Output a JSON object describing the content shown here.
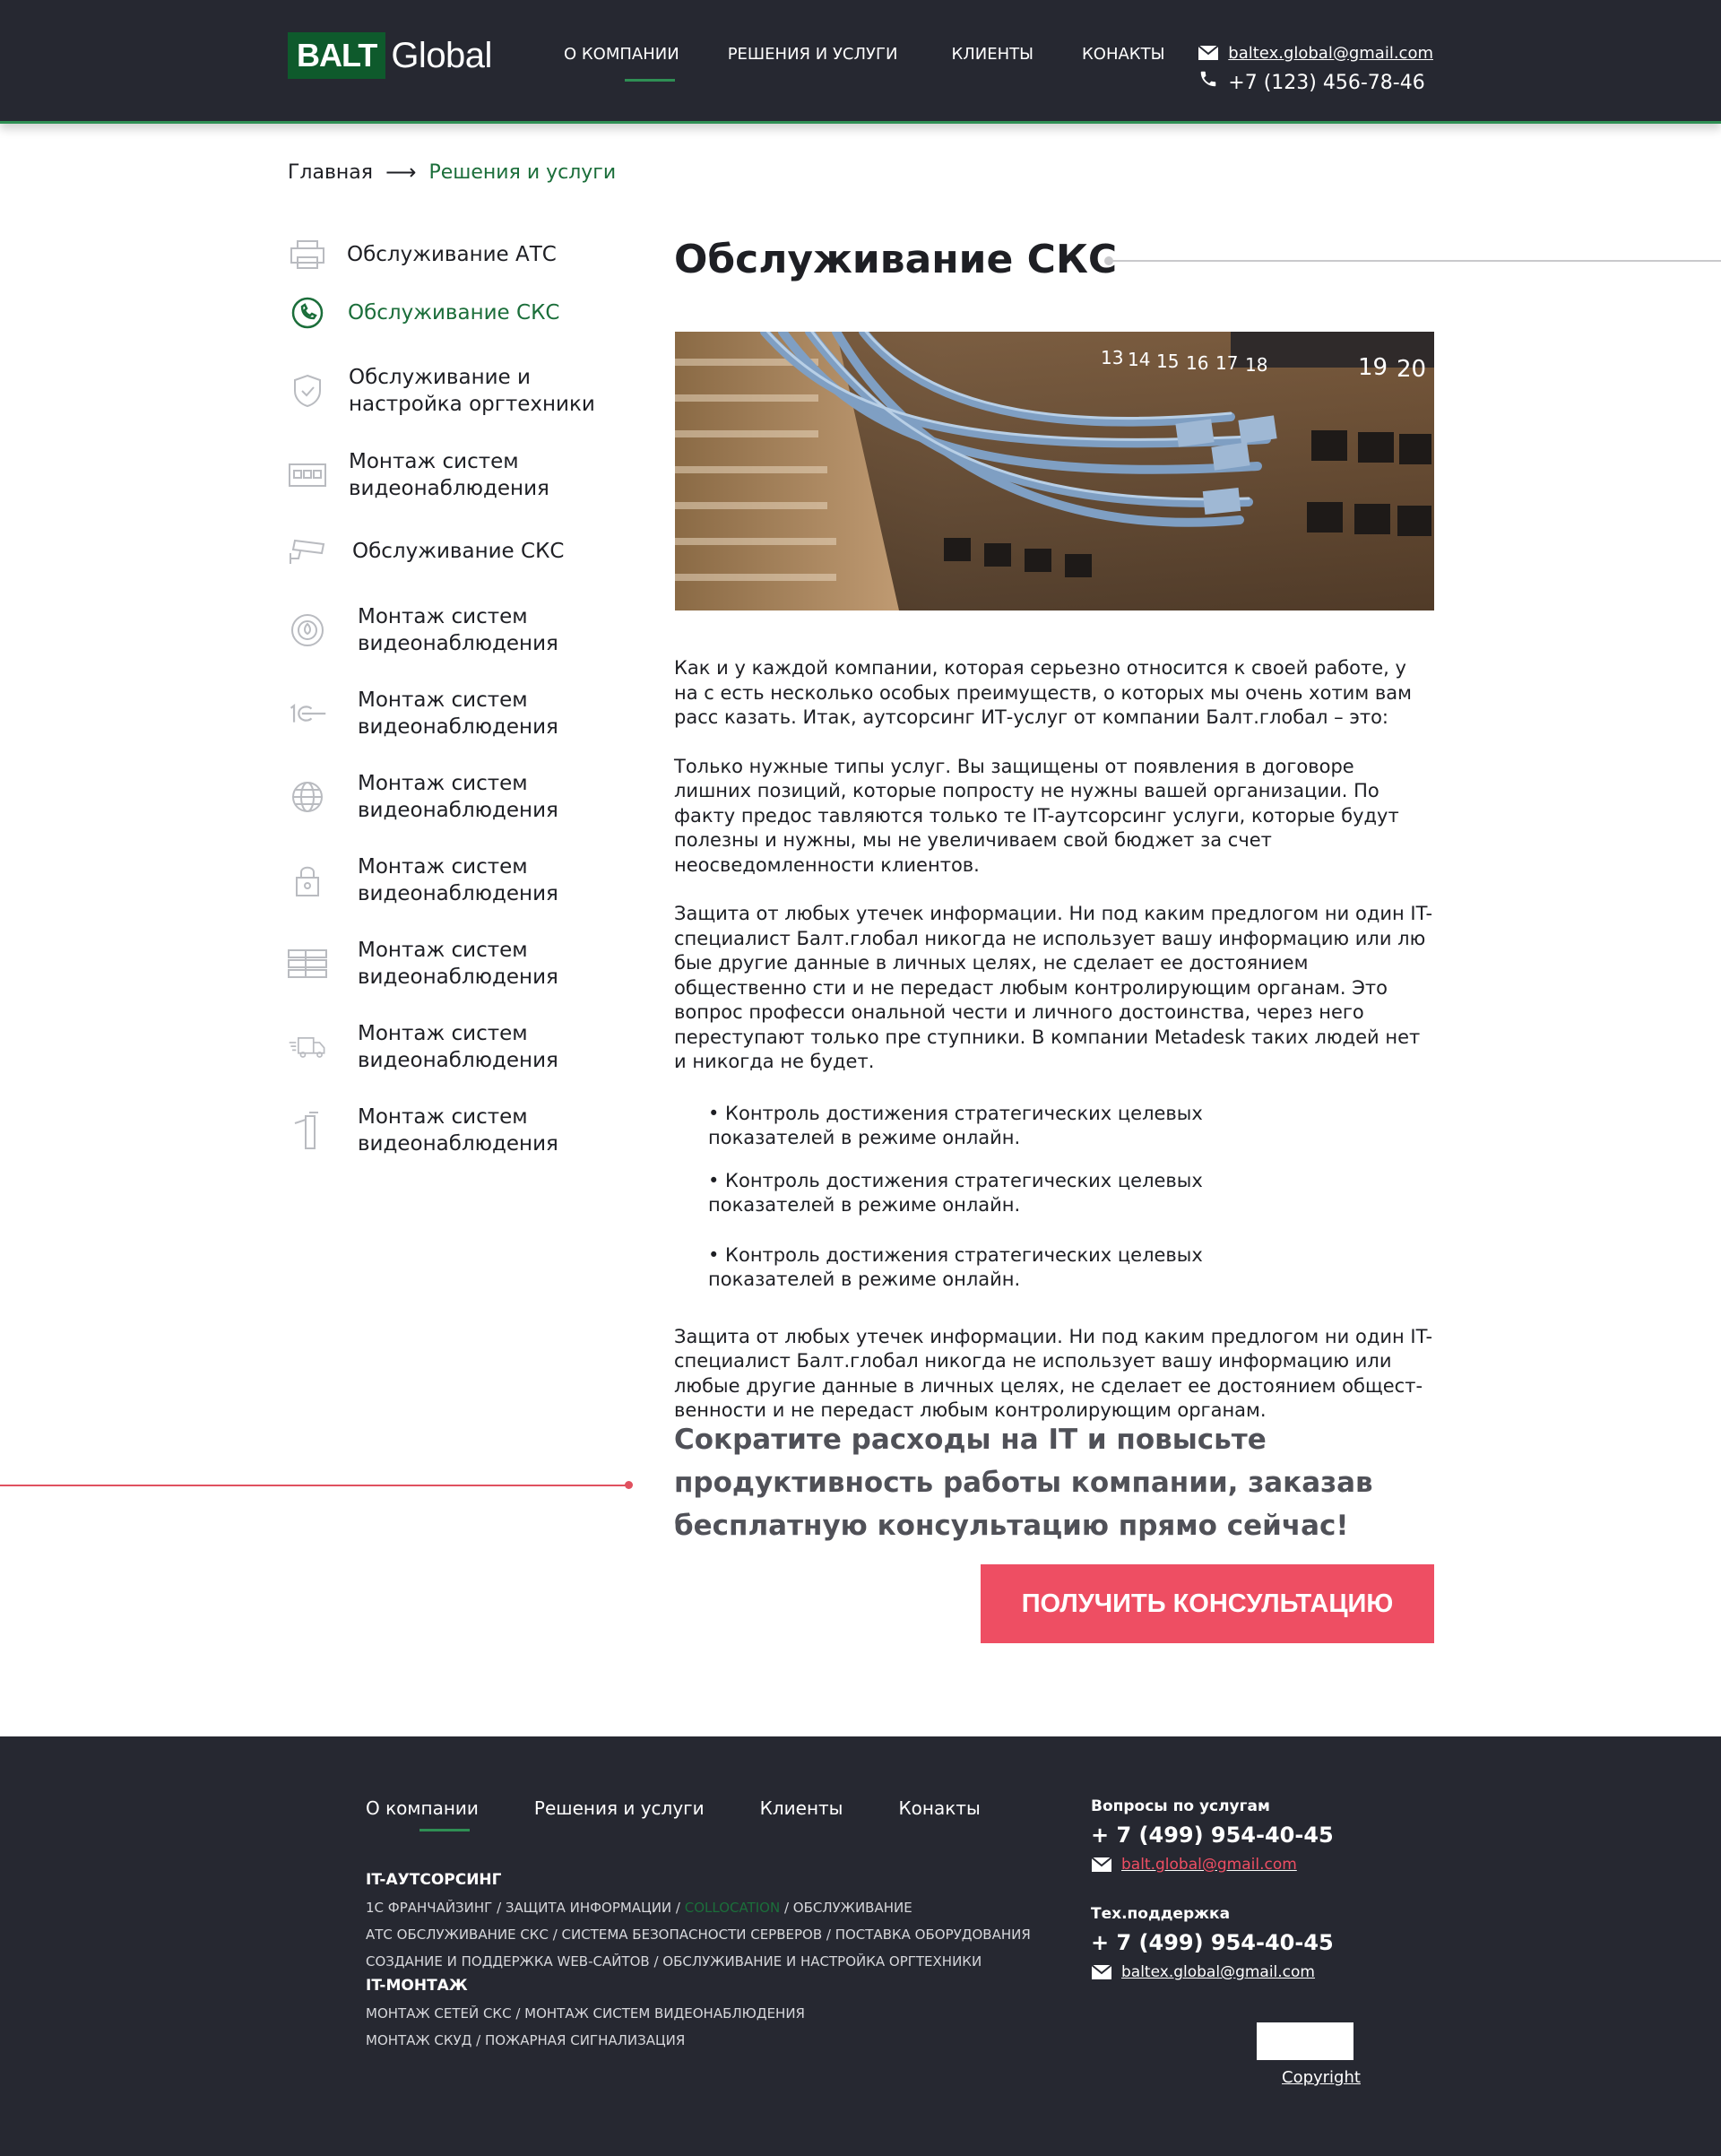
{
  "header": {
    "logo_box": "BALT",
    "logo_text": "Global",
    "nav": [
      "О КОМПАНИИ",
      "РЕШЕНИЯ И УСЛУГИ",
      "КЛИЕНТЫ",
      "КОНАКТЫ"
    ],
    "email": "baltex.global@gmail.com",
    "phone": "+7 (123) 456-78-46"
  },
  "breadcrumb": {
    "home": "Главная",
    "arrow": "⟶",
    "current": "Решения и услуги"
  },
  "sidebar": {
    "items": [
      {
        "label": "Обслуживание АТС",
        "icon": "printer-icon"
      },
      {
        "label": "Обслуживание СКС",
        "icon": "phone-circle-icon"
      },
      {
        "label": "Обслуживание и настройка оргтехники",
        "icon": "shield-icon"
      },
      {
        "label": "Монтаж систем видеонаблюдения",
        "icon": "server-panel-icon"
      },
      {
        "label": "Обслуживание СКС",
        "icon": "cctv-camera-icon"
      },
      {
        "label": "Монтаж систем видеонаблюдения",
        "icon": "fire-alarm-icon"
      },
      {
        "label": "Монтаж систем видеонаблюдения",
        "icon": "1c-logo-icon"
      },
      {
        "label": "Монтаж систем видеонаблюдения",
        "icon": "globe-icon"
      },
      {
        "label": "Монтаж систем видеонаблюдения",
        "icon": "lock-icon"
      },
      {
        "label": "Монтаж систем видеонаблюдения",
        "icon": "server-rack-icon"
      },
      {
        "label": "Монтаж систем видеонаблюдения",
        "icon": "delivery-truck-icon"
      },
      {
        "label": "Монтаж систем видеонаблюдения",
        "icon": "turnstile-icon"
      }
    ]
  },
  "main": {
    "title": "Обслуживание СКС",
    "p1": "Как и у каждой компании, которая серьезно относится к своей работе, у на с есть несколько особых преимуществ, о которых мы очень хотим вам расс казать. Итак, аутсорсинг ИТ-услуг от компании Балт.глобал – это:",
    "p2": "Только нужные типы услуг. Вы защищены от появления в договоре лишних позиций, которые попросту не нужны вашей организации. По факту предос тавляются только те IT-аутсорсинг услуги, которые будут полезны и нужны, мы не увеличиваем свой бюджет за счет неосведомленности клиентов.",
    "p3": "Защита от любых утечек информации. Ни под каким предлогом ни один IT-специалист Балт.глобал никогда не использует вашу информацию или лю бые другие данные в личных целях, не сделает ее достоянием общественно сти и не передаст любым контролирующим органам. Это вопрос професси ональной чести и личного достоинства, через него переступают только пре ступники. В компании Metadesk таких людей нет и никогда не будет.",
    "bullets": [
      "• Контроль достижения стратегических целевых показателей в режиме онлайн.",
      "• Контроль достижения стратегических целевых показателей в режиме онлайн.",
      "• Контроль достижения стратегических целевых показателей в режиме онлайн."
    ],
    "p4": "Защита от любых утечек информации. Ни под каким предлогом ни один IT-специалист Балт.глобал никогда не использует вашу информацию или любые другие данные в личных целях, не сделает ее достоянием общест- венности и не передаст любым контролирующим органам.",
    "cta_text": "Сократите расходы на IT и повысьте продуктивность работы компании, заказав бесплатную консультацию прямо сейчас!",
    "cta_button": "ПОЛУЧИТЬ КОНСУЛЬТАЦИЮ"
  },
  "footer": {
    "nav": [
      "О компании",
      "Решения и услуги",
      "Клиенты",
      "Конакты"
    ],
    "head1": "IT-АУТСОРСИНГ",
    "line1a": "1С ФРАНЧАЙЗИНГ / ЗАЩИТА ИНФОРМАЦИИ / ",
    "line1b": "COLLOCATION",
    "line1c": " / ОБСЛУЖИВАНИЕ",
    "line2": "АТС ОБСЛУЖИВАНИЕ СКС / СИСТЕМА БЕЗОПАСНОСТИ СЕРВЕРОВ / ПОСТАВКА ОБОРУДОВАНИЯ",
    "line3": "СОЗДАНИЕ И ПОДДЕРЖКА WEB-САЙТОВ / ОБСЛУЖИВАНИЕ И НАСТРОЙКА ОРГТЕХНИКИ",
    "head2": "IT-МОНТАЖ",
    "line4": "МОНТАЖ СЕТЕЙ СКС / МОНТАЖ СИСТЕМ ВИДЕОНАБЛЮДЕНИЯ",
    "line5": "МОНТАЖ СКУД / ПОЖАРНАЯ СИГНАЛИЗАЦИЯ",
    "services_head": "Вопросы по услугам",
    "services_phone": "+ 7 (499) 954-40-45",
    "services_email": "balt.global@gmail.com",
    "support_head": "Тех.поддержка",
    "support_phone": "+ 7 (499) 954-40-45",
    "support_email": "baltex.global@gmail.com",
    "copyright": "Copyright"
  },
  "colors": {
    "header_bg": "#262831",
    "accent_green": "#1b6e3a",
    "accent_red": "#ee4e63"
  }
}
